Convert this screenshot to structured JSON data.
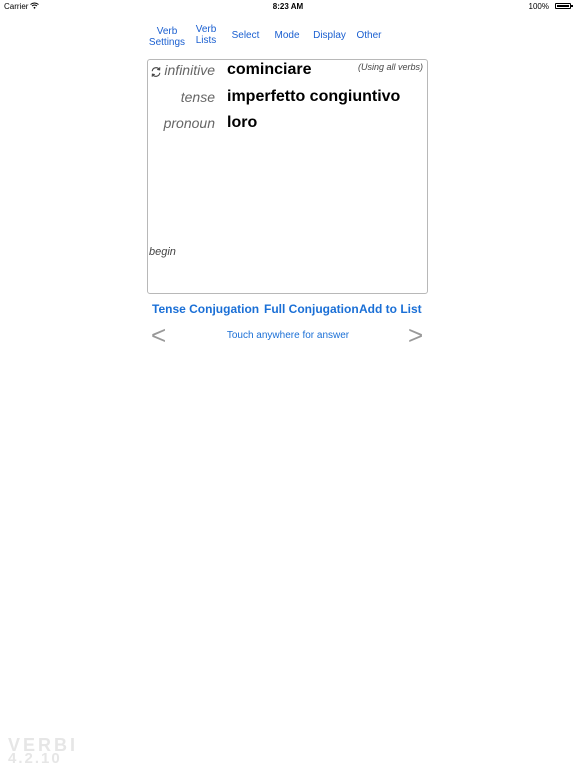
{
  "status": {
    "carrier": "Carrier",
    "time": "8:23 AM",
    "battery": "100%"
  },
  "nav": {
    "verb_settings_1": "Verb",
    "verb_settings_2": "Settings",
    "verb_lists_1": "Verb",
    "verb_lists_2": "Lists",
    "select": "Select",
    "mode": "Mode",
    "display": "Display",
    "other": "Other"
  },
  "card": {
    "using_note": "(Using all verbs)",
    "infinitive_label": "infinitive",
    "infinitive_value": "cominciare",
    "tense_label": "tense",
    "tense_value": "imperfetto congiuntivo",
    "pronoun_label": "pronoun",
    "pronoun_value": "loro",
    "begin": "begin"
  },
  "actions": {
    "tense_conjugation": "Tense Conjugation",
    "full_conjugation": "Full Conjugation",
    "add_to_list": "Add to List"
  },
  "navigation": {
    "prev": "<",
    "next": ">",
    "hint": "Touch anywhere for answer"
  },
  "logo": {
    "name": "VERBI",
    "version": "4.2.10"
  },
  "colors": {
    "link": "#1a6fd6",
    "label": "#666666",
    "arrow": "#999999",
    "logo": "#e6e6e6"
  }
}
